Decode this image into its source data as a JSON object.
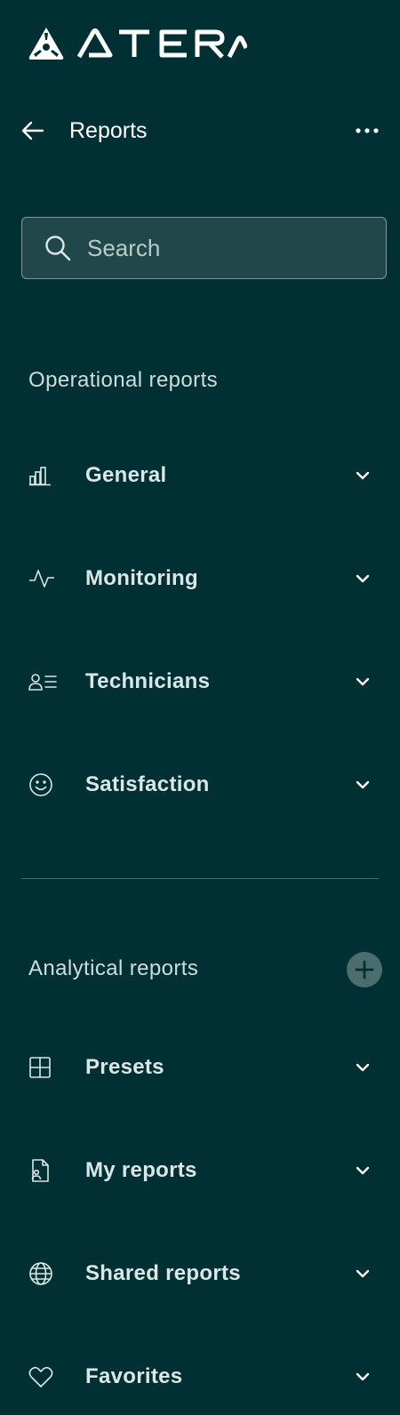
{
  "brand": {
    "logo_text": "ATERA",
    "colors": {
      "background": "#003034",
      "text": "#dbe6e6",
      "search_bg": "#22474a",
      "add_button_bg": "#4c6d6e"
    }
  },
  "header": {
    "back_icon": "arrow-left-icon",
    "title": "Reports",
    "more_icon": "more-horizontal-icon"
  },
  "search": {
    "placeholder": "Search",
    "value": "",
    "icon": "search-icon"
  },
  "operational": {
    "title": "Operational reports",
    "items": [
      {
        "label": "General",
        "icon": "bar-chart-icon"
      },
      {
        "label": "Monitoring",
        "icon": "activity-pulse-icon"
      },
      {
        "label": "Technicians",
        "icon": "user-list-icon"
      },
      {
        "label": "Satisfaction",
        "icon": "smiley-icon"
      }
    ]
  },
  "analytical": {
    "title": "Analytical reports",
    "add_icon": "plus-icon",
    "items": [
      {
        "label": "Presets",
        "icon": "grid-icon"
      },
      {
        "label": "My reports",
        "icon": "user-document-icon"
      },
      {
        "label": "Shared reports",
        "icon": "globe-icon"
      },
      {
        "label": "Favorites",
        "icon": "heart-icon"
      }
    ]
  }
}
